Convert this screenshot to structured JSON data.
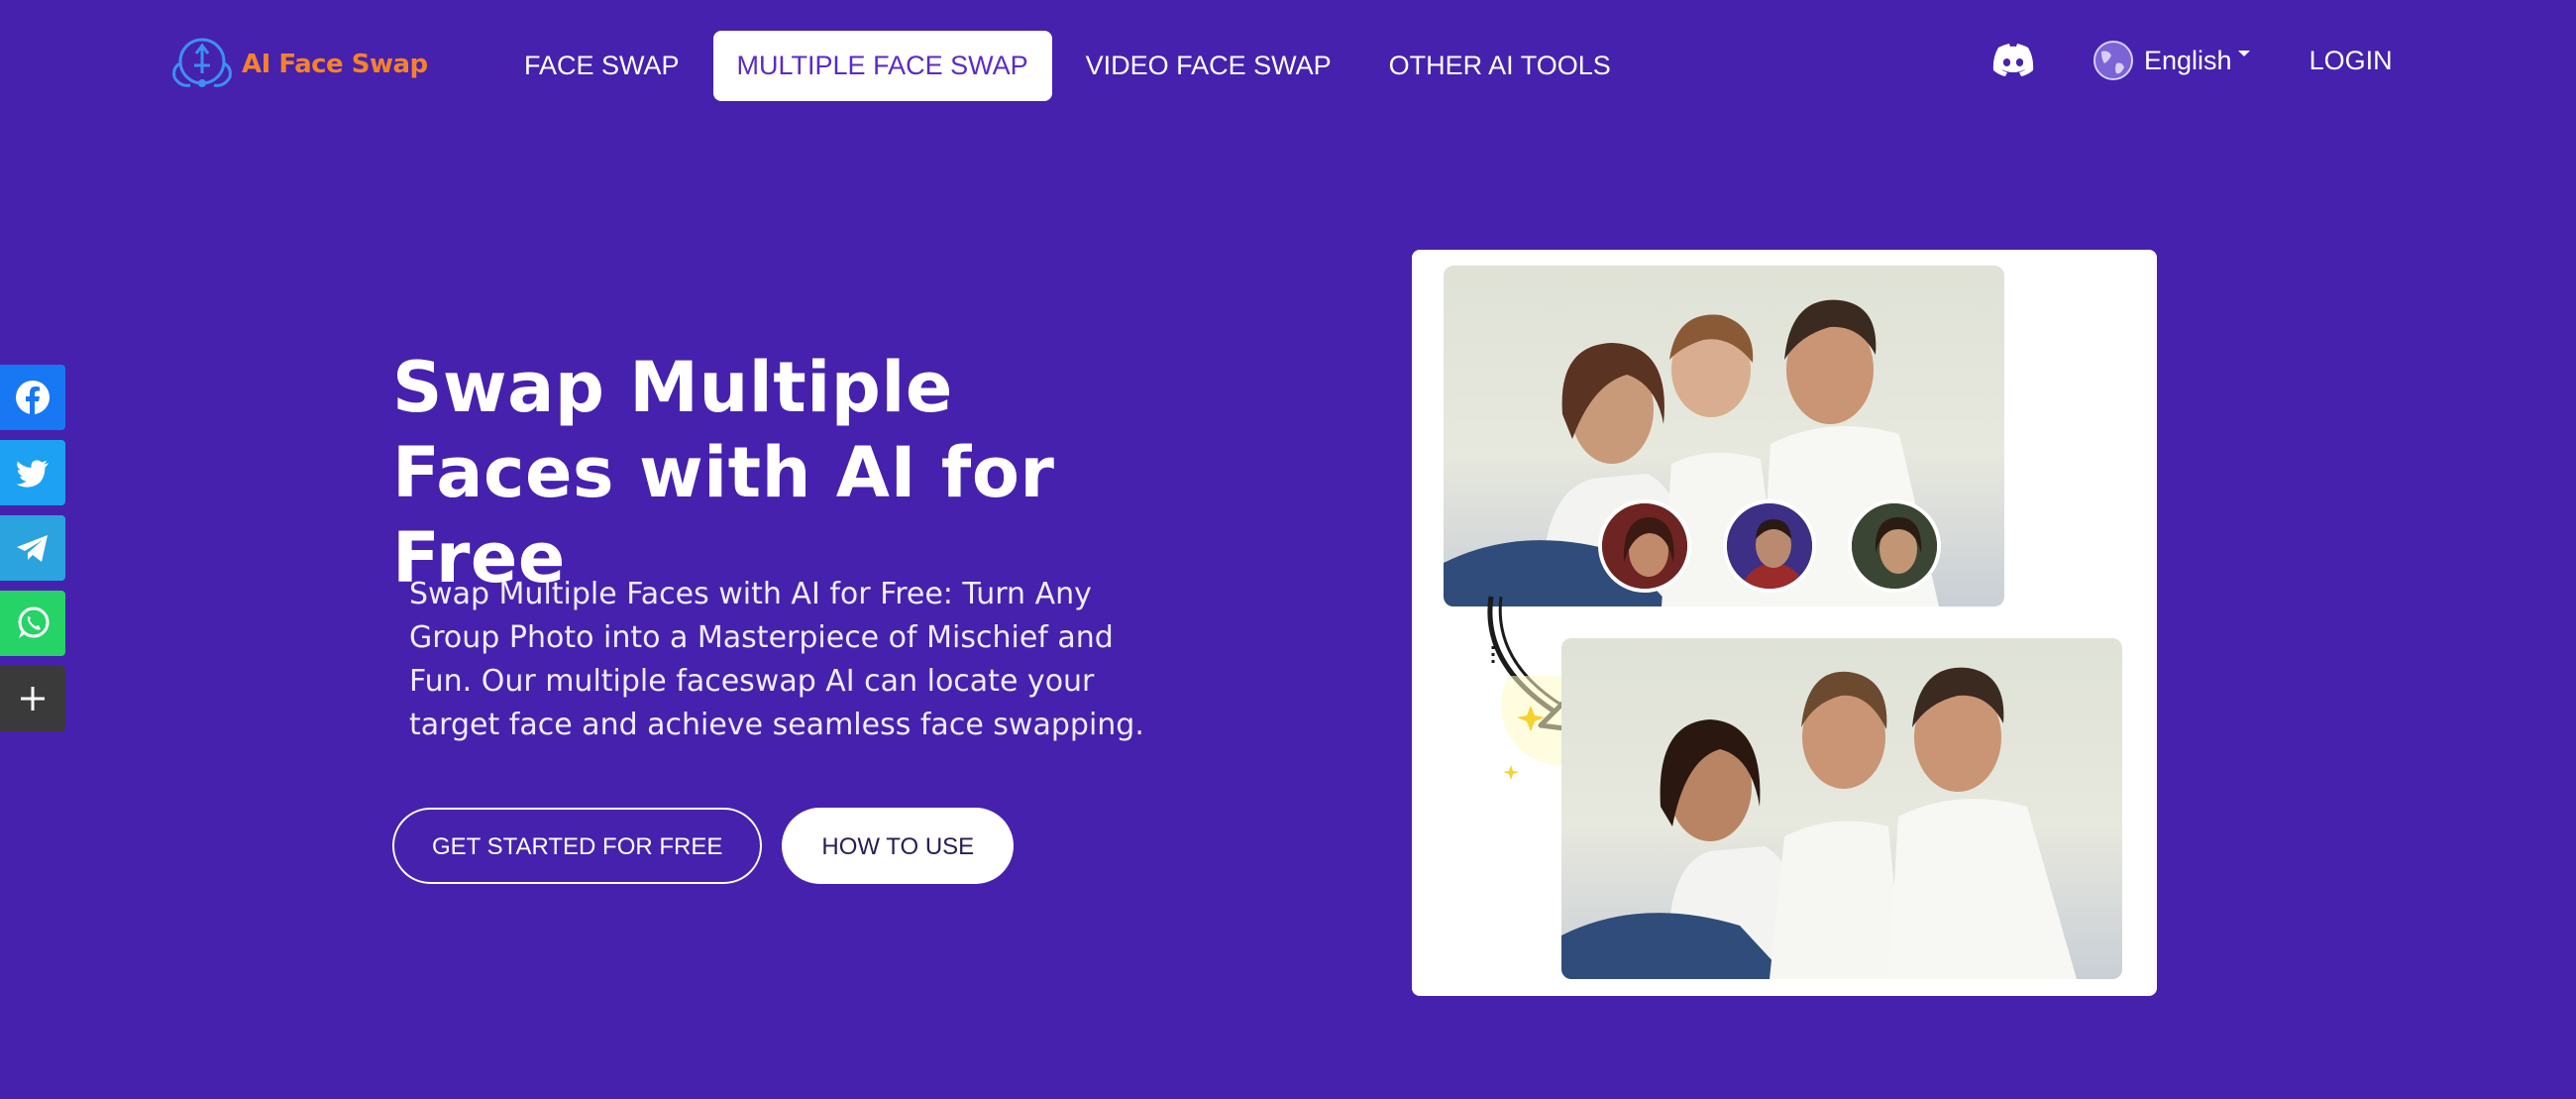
{
  "brand": {
    "name": "AI Face Swap",
    "accent": "#f5822a",
    "background": "#4521ae"
  },
  "nav": {
    "items": [
      {
        "label": "FACE SWAP"
      },
      {
        "label": "MULTIPLE FACE SWAP",
        "active": true
      },
      {
        "label": "VIDEO FACE SWAP"
      },
      {
        "label": "OTHER AI TOOLS"
      }
    ]
  },
  "header": {
    "language": "English",
    "login_label": "LOGIN",
    "icons": [
      "discord-icon",
      "globe-icon",
      "chevron-down-icon"
    ]
  },
  "social": {
    "items": [
      {
        "name": "facebook",
        "icon": "facebook-icon",
        "color": "#1877f2"
      },
      {
        "name": "twitter",
        "icon": "twitter-icon",
        "color": "#1da1f2"
      },
      {
        "name": "telegram",
        "icon": "telegram-icon",
        "color": "#2aa3df"
      },
      {
        "name": "whatsapp",
        "icon": "whatsapp-icon",
        "color": "#25d366"
      },
      {
        "name": "more",
        "icon": "plus-icon",
        "color": "#3a3a3a"
      }
    ]
  },
  "hero": {
    "title": "Swap Multiple Faces with AI for Free",
    "description": "Swap Multiple Faces with AI for Free: Turn Any Group Photo into a Masterpiece of Mischief and Fun. Our multiple faceswap AI can locate your target face and achieve seamless face swapping.",
    "primary_button": "GET STARTED FOR FREE",
    "secondary_button": "HOW TO USE"
  }
}
